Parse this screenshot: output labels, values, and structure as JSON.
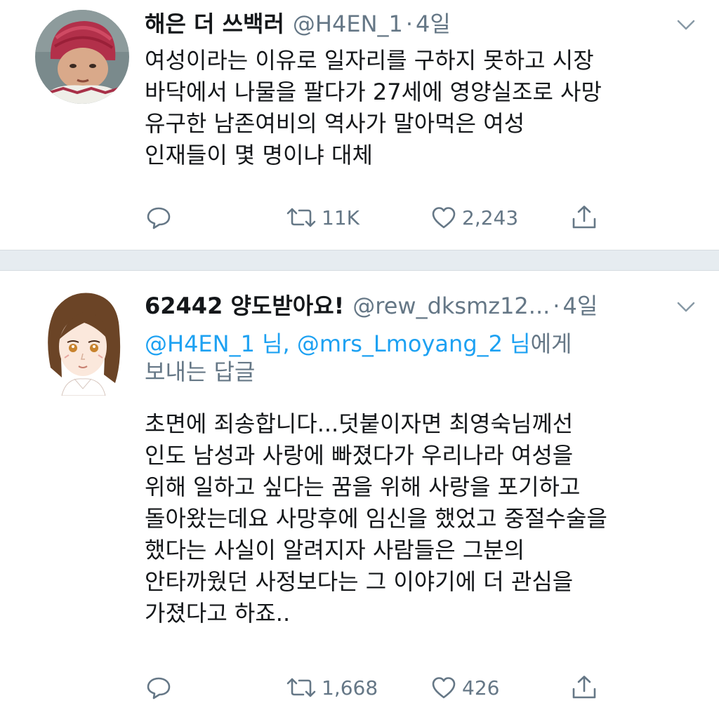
{
  "tweets": [
    {
      "display_name": "해은 더 쓰백러",
      "handle": "@H4EN_1",
      "separator": "·",
      "time": "4일",
      "lines": [
        "여성이라는 이유로 일자리를 구하지 못하고 시장",
        "바닥에서 나물을 팔다가 27세에 영양실조로 사망",
        "유구한 남존여비의 역사가 말아먹은 여성",
        "인재들이 몇 명이냐 대체"
      ],
      "retweets": "11K",
      "likes": "2,243"
    },
    {
      "display_name": "62442 양도받아요!",
      "handle": "@rew_dksmz12...",
      "separator": "·",
      "time": "4일",
      "reply_to": {
        "mention_1": "@H4EN_1 님,",
        "mention_2": "@mrs_Lmoyang_2 님",
        "suffix": "에게",
        "line2": "보내는 답글"
      },
      "lines": [
        "초면에 죄송합니다...덧붙이자면 최영숙님께선",
        "인도 남성과 사랑에 빠졌다가 우리나라 여성을",
        "위해 일하고 싶다는 꿈을 위해 사랑을 포기하고",
        "돌아왔는데요 사망후에 임신을 했었고 중절수술을",
        "했다는 사실이 알려지자 사람들은 그분의",
        "안타까웠던 사정보다는 그 이야기에 더 관심을",
        "가졌다고 하죠.."
      ],
      "retweets": "1,668",
      "likes": "426"
    }
  ],
  "colors": {
    "text": "#14171a",
    "secondary": "#657786",
    "link": "#1da1f2",
    "divider": "#e6ecf0"
  },
  "icons": [
    "reply-icon",
    "retweet-icon",
    "like-icon",
    "share-icon",
    "chevron-down-icon"
  ]
}
